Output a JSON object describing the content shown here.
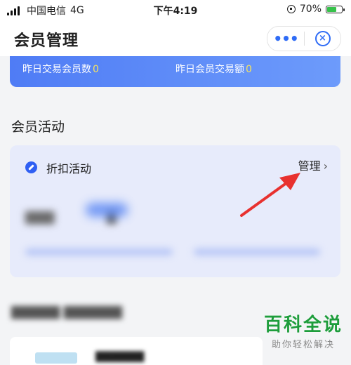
{
  "status_bar": {
    "carrier": "中国电信",
    "network": "4G",
    "time": "下午4:19",
    "battery_percent_label": "70%",
    "battery_level": 0.7
  },
  "nav": {
    "title": "会员管理",
    "more_icon": "more-dots-icon",
    "close_icon": "close-target-icon"
  },
  "stats": {
    "yesterday_members_label": "昨日交易会员数",
    "yesterday_members_value": "0",
    "yesterday_amount_label": "昨日会员交易额",
    "yesterday_amount_value": "0"
  },
  "activity": {
    "section_title": "会员活动",
    "discount_label": "折扣活动",
    "manage_label": "管理",
    "chevron": "›"
  },
  "watermark": {
    "title": "百科全说",
    "subtitle": "助你轻松解决"
  },
  "colors": {
    "accent": "#2f6cf6",
    "stat_number": "#f8e45c",
    "watermark_green": "#1e9d3c",
    "annotation_arrow": "#e8312f"
  }
}
